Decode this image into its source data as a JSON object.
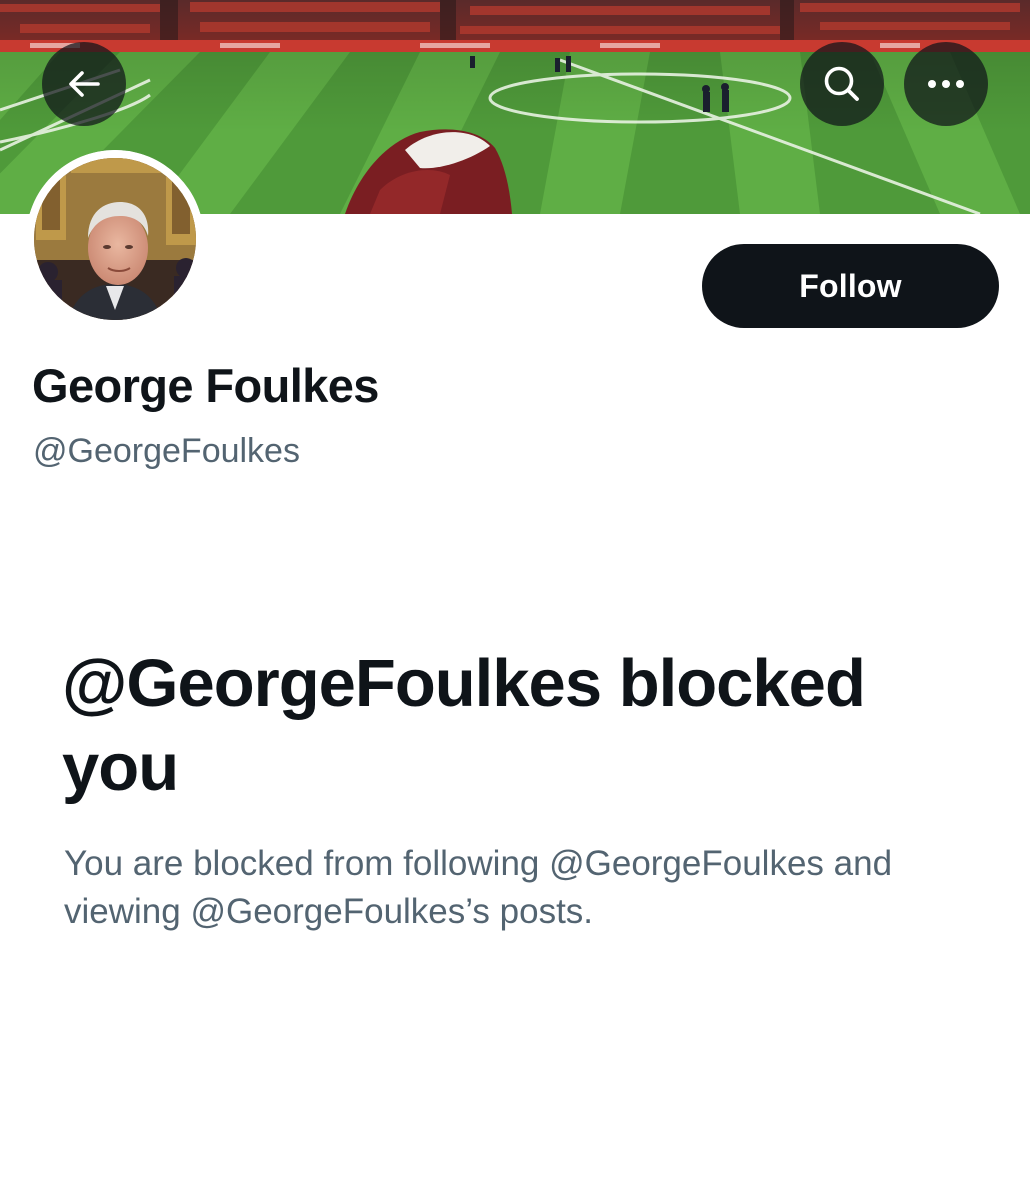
{
  "profile": {
    "display_name": "George Foulkes",
    "handle": "@GeorgeFoulkes"
  },
  "header": {
    "back_icon": "arrow-left-icon",
    "search_icon": "search-icon",
    "more_icon": "more-horizontal-icon"
  },
  "actions": {
    "follow_label": "Follow"
  },
  "blocked": {
    "title": "@GeorgeFoulkes blocked you",
    "description": "You are blocked from following @GeorgeFoulkes and viewing @GeorgeFoulkes’s posts."
  },
  "colors": {
    "primary_text": "#0f1419",
    "secondary_text": "#536471",
    "button_bg": "#0f1419",
    "button_text": "#ffffff"
  }
}
